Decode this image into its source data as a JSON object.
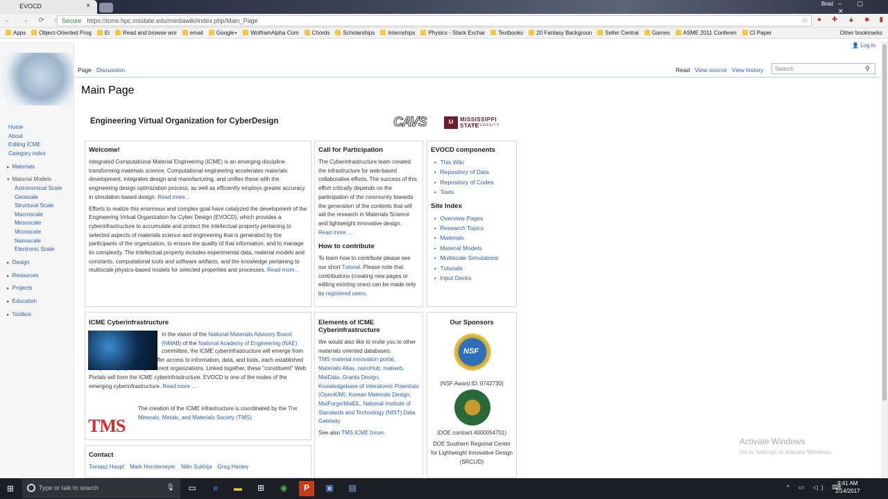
{
  "browser": {
    "tab_title": "EVOCD",
    "tab_close": "×",
    "profile": "Brad",
    "window_controls": "– ▢ ✕",
    "nav": "← → ⟳ ⌂",
    "secure": "Secure",
    "url": "https://icme.hpc.msstate.edu/mediawiki/index.php/Main_Page",
    "star": "☆",
    "extensions": "● ✚ ▲ ■ ▮",
    "bookmarks": [
      "Apps",
      "Object-Oriented Prog",
      "El",
      "Read and browse wor",
      "email",
      "Google+",
      "WolframAlpha Com",
      "Chords",
      "Scholarships",
      "Internships",
      "Physics - Stack Exchar",
      "Textbooks",
      "20 Fantasy Backgroun",
      "Seller Central",
      "Games",
      "ASME 2011 Conferen",
      "CI Paper"
    ],
    "other_bookmarks": "Other bookmarks"
  },
  "wiki": {
    "login": "Log in",
    "tab_page": "Page",
    "tab_discussion": "Discussion",
    "tab_read": "Read",
    "tab_view_source": "View source",
    "tab_view_history": "View history",
    "search_placeholder": "Search",
    "search_icon": "⚲",
    "page_title": "Main Page",
    "sidebar": {
      "home": "Home",
      "about": "About",
      "editing": "Editing ICME",
      "category": "Category index",
      "materials": "Materials",
      "material_models": "Material Models",
      "models": [
        "Astronomical Scale",
        "Geoscale",
        "Structural Scale",
        "Macroscale",
        "Mesoscale",
        "Microscale",
        "Nanoscale",
        "Electronic Scale"
      ],
      "design": "Design",
      "resources": "Resources",
      "projects": "Projects",
      "education": "Education",
      "toolbox": "Toolbox"
    },
    "headline": "Engineering Virtual Organization for CyberDesign",
    "cavs": "CAVS",
    "ms_seal": "M",
    "ms_name": "MISSISSIPPI STATE",
    "ms_univ": "UNIVERSITY",
    "welcome": {
      "title": "Welcome!",
      "p1": "Integrated Computational Material Engineering (ICME) is an emerging discipline transforming materials science. Computational engineering accelerates materials development, integrates design and manufacturing, and unifies these with the engineering design optimization process, as well as efficiently employs greater accuracy in simulation-based design.",
      "more1": "Read more...",
      "p2": "Efforts to realize this enormous and complex goal have catalyzed the development of the Engineering Virtual Organization for Cyber Design (EVOCD), which provides a cyberinfrastructure to accumulate and protect the intellectual property pertaining to selected aspects of materials science and engineering that is generated by the participants of the organization, to ensure the quality of that information, and to manage its complexity. The intellectual property includes experimental data, material models and constants, computational tools and software artifacts, and the knowledge pertaining to multiscale physics-based models for selected properties and processes.",
      "more2": "Read more..."
    },
    "call": {
      "title": "Call for Participation",
      "p": "The Cyberinfrastructure team created the infrastructure for web-based collaborative efforts. The success of this effort critically depends on the participation of the community towards the generation of the contents that will aid the research in Materials Science and lightweight innovative design.",
      "more": "Read more ...",
      "howto": "How to contribute",
      "howto_p1": "To learn how to contribute please see our short",
      "tutorial": "Tutorial",
      "howto_p2": ". Please note that contributions (creating new pages or editing existing ones) can be made only by",
      "registered": "registered users",
      "dot": "."
    },
    "components": {
      "title": "EVOCD components",
      "items": [
        "This Wiki",
        "Repository of Data",
        "Repository of Codes",
        "Tools"
      ],
      "site_index": "Site Index",
      "index_items": [
        "Overview Pages",
        "Research Topics",
        "Materials",
        "Material Models",
        "Multiscale Simulations",
        "Tutorials",
        "Input Decks"
      ]
    },
    "cyber": {
      "title": "ICME Cyberinfrastructure",
      "p_a": "In the vision of the",
      "nmab": "National Materials Advisory Board (NMAB)",
      "p_b": "of the",
      "nae": "National Academy of Engineering (NAE)",
      "p_c": "committee, the ICME cyberinfrastructure will emerge from individual web sites which offer access to information, data, and tools, each established for specific purposes by different organizations. Linked together, these \"constituent\" Web Portals will form the ICME cyberinfrastructure. EVOCD is one of the nodes of the emerging cyberinfrastructure.",
      "more": "Read more ...",
      "tms_logo": "TMS",
      "tms_p": "The creation of the ICME infrastructure is coordinated by the",
      "tms_link": "The Minerals, Metals, and Materials Society (TMS)"
    },
    "contact": {
      "title": "Contact",
      "people": [
        "Tomasz Haupt",
        "Mark Horstemeyer",
        "Nitin Sukhija",
        "Greg Henley"
      ]
    },
    "elements": {
      "title": "Elements of ICME Cyberinfrastructure",
      "intro": "We would also like to invite you to other materials oriented databases:",
      "links": "TMS material innovation portal, Materials Atlas, nanoHub, matweb, MatData, Granta Design, Knowledgebase of Interatomic Potentials (OpenKIM), Korean Materials Design, MatForge/MatDL, National Institute of Standards and Technology (NIST) Data Gateway",
      "see_also": "See also",
      "forum": "TMS ICME forum"
    },
    "sponsors": {
      "title": "Our Sponsors",
      "nsf_logo": "NSF",
      "nsf": "(NSF Award ID: 0742730)",
      "doe": "(DOE contract 4000054701)",
      "srclid": "DOE Southern Regional Center for Lightweight Innovative Design (SRCLID)"
    },
    "activate_title": "Activate Windows",
    "activate_sub": "Go to Settings to activate Windows."
  },
  "taskbar": {
    "start": "⊞",
    "search_placeholder": "Type or talk to search",
    "mic": "🎙",
    "tray": "^ ▭ ◁) ⌨",
    "time": "9:41 AM",
    "date": "2/14/2017"
  }
}
